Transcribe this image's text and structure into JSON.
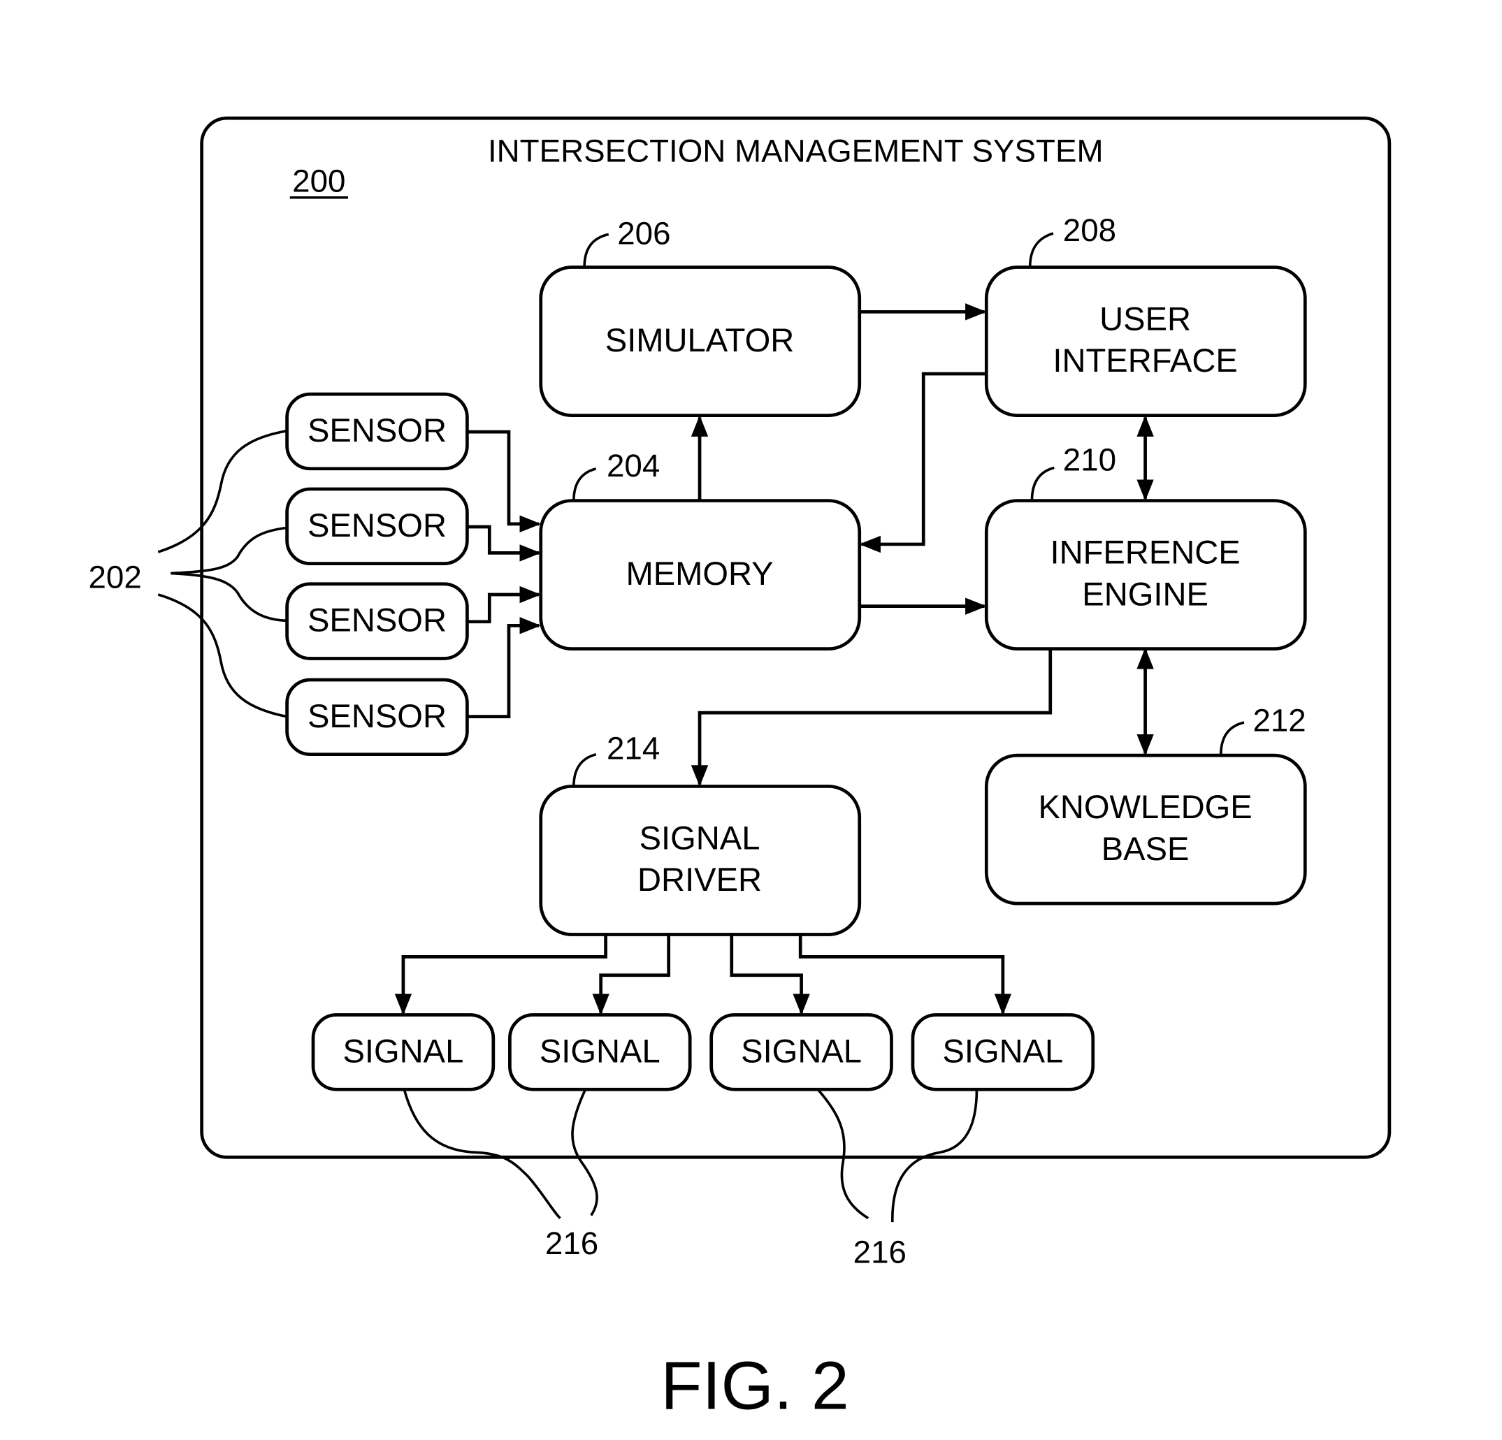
{
  "figure": {
    "title": "INTERSECTION MANAGEMENT SYSTEM",
    "system_ref": "200",
    "caption": "FIG. 2"
  },
  "blocks": {
    "simulator": {
      "ref": "206",
      "lines": [
        "SIMULATOR"
      ]
    },
    "user_interface": {
      "ref": "208",
      "lines": [
        "USER",
        "INTERFACE"
      ]
    },
    "memory": {
      "ref": "204",
      "lines": [
        "MEMORY"
      ]
    },
    "inference_engine": {
      "ref": "210",
      "lines": [
        "INFERENCE",
        "ENGINE"
      ]
    },
    "knowledge_base": {
      "ref": "212",
      "lines": [
        "KNOWLEDGE",
        "BASE"
      ]
    },
    "signal_driver": {
      "ref": "214",
      "lines": [
        "SIGNAL",
        "DRIVER"
      ]
    }
  },
  "sensors": {
    "ref": "202",
    "items": [
      "SENSOR",
      "SENSOR",
      "SENSOR",
      "SENSOR"
    ]
  },
  "signals": {
    "refs": [
      "216",
      "216"
    ],
    "items": [
      "SIGNAL",
      "SIGNAL",
      "SIGNAL",
      "SIGNAL"
    ]
  },
  "connections": [
    {
      "from": "sensors",
      "to": "memory",
      "direction": "one-way"
    },
    {
      "from": "memory",
      "to": "simulator",
      "direction": "one-way"
    },
    {
      "from": "simulator",
      "to": "user_interface",
      "direction": "one-way"
    },
    {
      "from": "user_interface",
      "to": "memory",
      "direction": "one-way"
    },
    {
      "from": "memory",
      "to": "inference_engine",
      "direction": "one-way"
    },
    {
      "from": "user_interface",
      "to": "inference_engine",
      "direction": "two-way"
    },
    {
      "from": "inference_engine",
      "to": "knowledge_base",
      "direction": "two-way"
    },
    {
      "from": "inference_engine",
      "to": "signal_driver",
      "direction": "one-way"
    },
    {
      "from": "signal_driver",
      "to": "signals",
      "direction": "one-way"
    }
  ]
}
